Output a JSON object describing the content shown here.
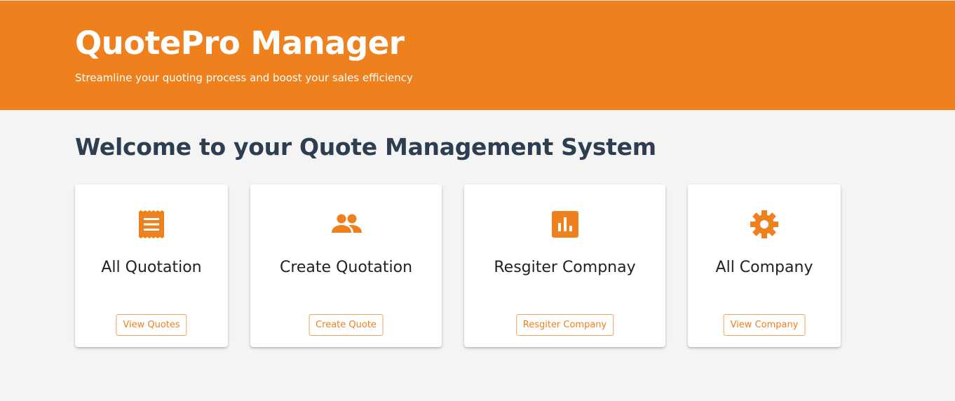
{
  "header": {
    "title": "QuotePro Manager",
    "subtitle": "Streamline your quoting process and boost your sales efficiency"
  },
  "main": {
    "welcome": "Welcome to your Quote Management System",
    "cards": [
      {
        "title": "All Quotation",
        "button": "View Quotes",
        "icon": "receipt-icon"
      },
      {
        "title": "Create Quotation",
        "button": "Create Quote",
        "icon": "people-icon"
      },
      {
        "title": "Resgiter Compnay",
        "button": "Resgiter Company",
        "icon": "bar-chart-icon"
      },
      {
        "title": "All Company",
        "button": "View Company",
        "icon": "gear-icon"
      }
    ]
  },
  "colors": {
    "accent": "#ee801e",
    "background": "#f4f4f4",
    "heading": "#2c3e50"
  }
}
